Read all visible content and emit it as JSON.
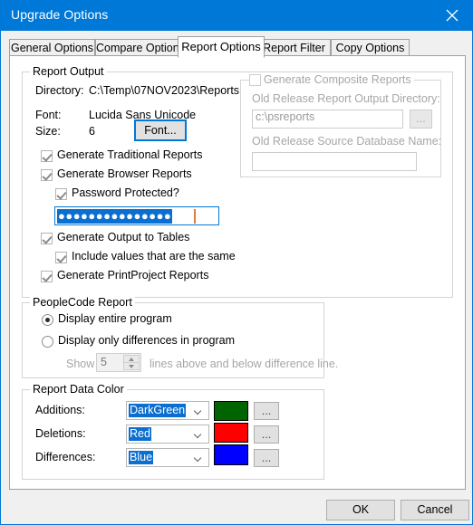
{
  "window": {
    "title": "Upgrade Options",
    "close_icon": "close-icon",
    "accent_color": "#0078d7"
  },
  "tabs": [
    {
      "label": "General Options",
      "active": false
    },
    {
      "label": "Compare Options",
      "active": false
    },
    {
      "label": "Report Options",
      "active": true
    },
    {
      "label": "Report Filter",
      "active": false
    },
    {
      "label": "Copy Options",
      "active": false
    }
  ],
  "report_output": {
    "legend": "Report Output",
    "directory_label": "Directory:",
    "directory_value": "C:\\Temp\\07NOV2023\\Reports",
    "font_label": "Font:",
    "font_value": "Lucida Sans Unicode",
    "size_label": "Size:",
    "size_value": "6",
    "font_button": "Font...",
    "checkboxes": [
      {
        "label": "Generate Traditional Reports",
        "checked": true
      },
      {
        "label": "Generate Browser Reports",
        "checked": true
      },
      {
        "label": "Password Protected?",
        "checked": true
      },
      {
        "label": "Generate Output to Tables",
        "checked": true
      },
      {
        "label": "Include values that are the same",
        "checked": true
      },
      {
        "label": "Generate PrintProject Reports",
        "checked": true
      }
    ],
    "password_value": "●●●●●●●●●●●●●●●",
    "password_selected": true
  },
  "composite": {
    "legend": "Generate Composite Reports",
    "checked": false,
    "old_release_dir_label": "Old Release Report Output Directory:",
    "old_release_dir_value": "c:\\psreports",
    "old_release_db_label": "Old Release Source Database Name:",
    "old_release_db_value": "",
    "browse_button": "...",
    "disabled": true
  },
  "peoplecode": {
    "legend": "PeopleCode Report",
    "options": [
      {
        "label": "Display entire program",
        "selected": true
      },
      {
        "label": "Display only differences in program",
        "selected": false
      }
    ],
    "show_label": "Show",
    "show_value": "5",
    "show_suffix": "lines above and below difference line."
  },
  "report_data_color": {
    "legend": "Report Data Color",
    "rows": [
      {
        "label": "Additions:",
        "value": "DarkGreen",
        "color": "#006400",
        "button": "..."
      },
      {
        "label": "Deletions:",
        "value": "Red",
        "color": "#ff0000",
        "button": "..."
      },
      {
        "label": "Differences:",
        "value": "Blue",
        "color": "#0000ff",
        "button": "..."
      }
    ]
  },
  "footer": {
    "ok": "OK",
    "cancel": "Cancel"
  }
}
